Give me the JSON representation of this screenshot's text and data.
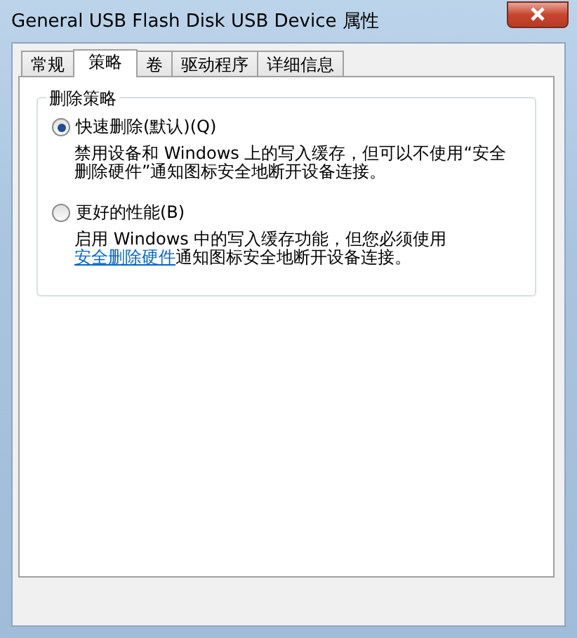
{
  "window": {
    "title": "General USB Flash Disk USB Device 属性"
  },
  "tabs": [
    {
      "label": "常规",
      "selected": false
    },
    {
      "label": "策略",
      "selected": true
    },
    {
      "label": "卷",
      "selected": false
    },
    {
      "label": "驱动程序",
      "selected": false
    },
    {
      "label": "详细信息",
      "selected": false
    }
  ],
  "group": {
    "title": "删除策略",
    "options": [
      {
        "label": "快速删除(默认)(Q)",
        "selected": true,
        "description": [
          [
            {
              "kind": "text",
              "text": "禁用设备和 Windows 上的写入缓存，但可以不使用“安全"
            }
          ],
          [
            {
              "kind": "text",
              "text": "删除硬件”通知图标安全地断开设备连接。"
            }
          ]
        ]
      },
      {
        "label": "更好的性能(B)",
        "selected": false,
        "description": [
          [
            {
              "kind": "text",
              "text": "启用 Windows 中的写入缓存功能，但您必须使用"
            }
          ],
          [
            {
              "kind": "link",
              "text": "安全删除硬件"
            },
            {
              "kind": "text",
              "text": "通知图标安全地断开设备连接。"
            }
          ]
        ]
      }
    ]
  }
}
